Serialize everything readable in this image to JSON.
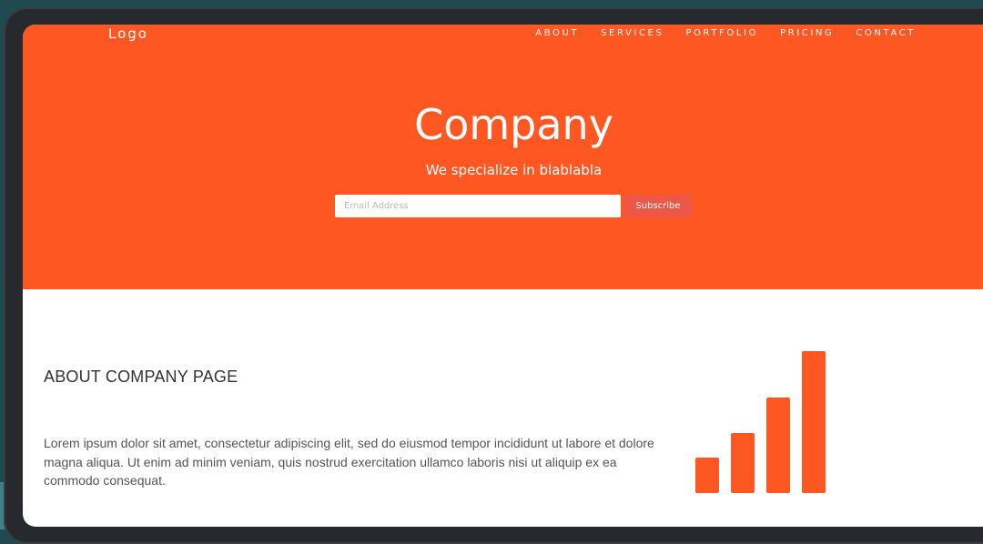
{
  "header": {
    "logo": "Logo",
    "nav": [
      "ABOUT",
      "SERVICES",
      "PORTFOLIO",
      "PRICING",
      "CONTACT"
    ]
  },
  "hero": {
    "title": "Company",
    "subtitle": "We specialize in blablabla",
    "email_placeholder": "Email Address",
    "subscribe_label": "Subscribe"
  },
  "about": {
    "title": "ABOUT COMPANY PAGE",
    "text": "Lorem ipsum dolor sit amet, consectetur adipiscing elit, sed do eiusmod tempor incididunt ut labore et dolore magna aliqua. Ut enim ad minim veniam, quis nostrud exercitation ullamco laboris nisi ut aliquip ex ea commodo consequat."
  },
  "signal_icon": {
    "name": "signal-bars-icon",
    "levels": [
      0.25,
      0.42,
      0.67,
      1.0
    ],
    "color": "#ff5722"
  },
  "colors": {
    "brand": "#ff5722",
    "subscribe": "#ee5648"
  }
}
